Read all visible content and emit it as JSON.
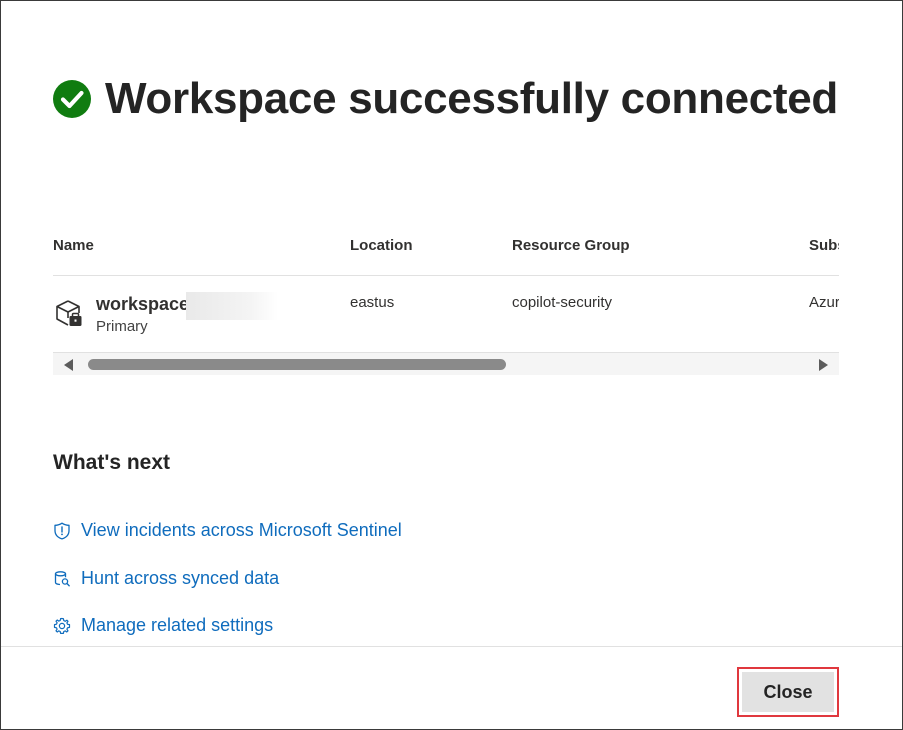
{
  "dialog": {
    "title": "Workspace successfully connected",
    "status_icon": "check-circle-icon",
    "accent_success": "#107c10"
  },
  "table": {
    "columns": [
      "Name",
      "Location",
      "Resource Group",
      "Subs"
    ],
    "rows": [
      {
        "name": "workspace",
        "name_redacted": true,
        "role": "Primary",
        "location": "eastus",
        "resource_group": "copilot-security",
        "subscription": "Azur",
        "icon": "workspace-package-icon"
      }
    ]
  },
  "whats_next": {
    "heading": "What's next",
    "links": [
      {
        "label": "View incidents across Microsoft Sentinel",
        "icon": "shield-icon"
      },
      {
        "label": "Hunt across synced data",
        "icon": "database-search-icon"
      },
      {
        "label": "Manage related settings",
        "icon": "gear-icon"
      }
    ],
    "link_color": "#0f6cbd"
  },
  "footer": {
    "close_label": "Close"
  }
}
